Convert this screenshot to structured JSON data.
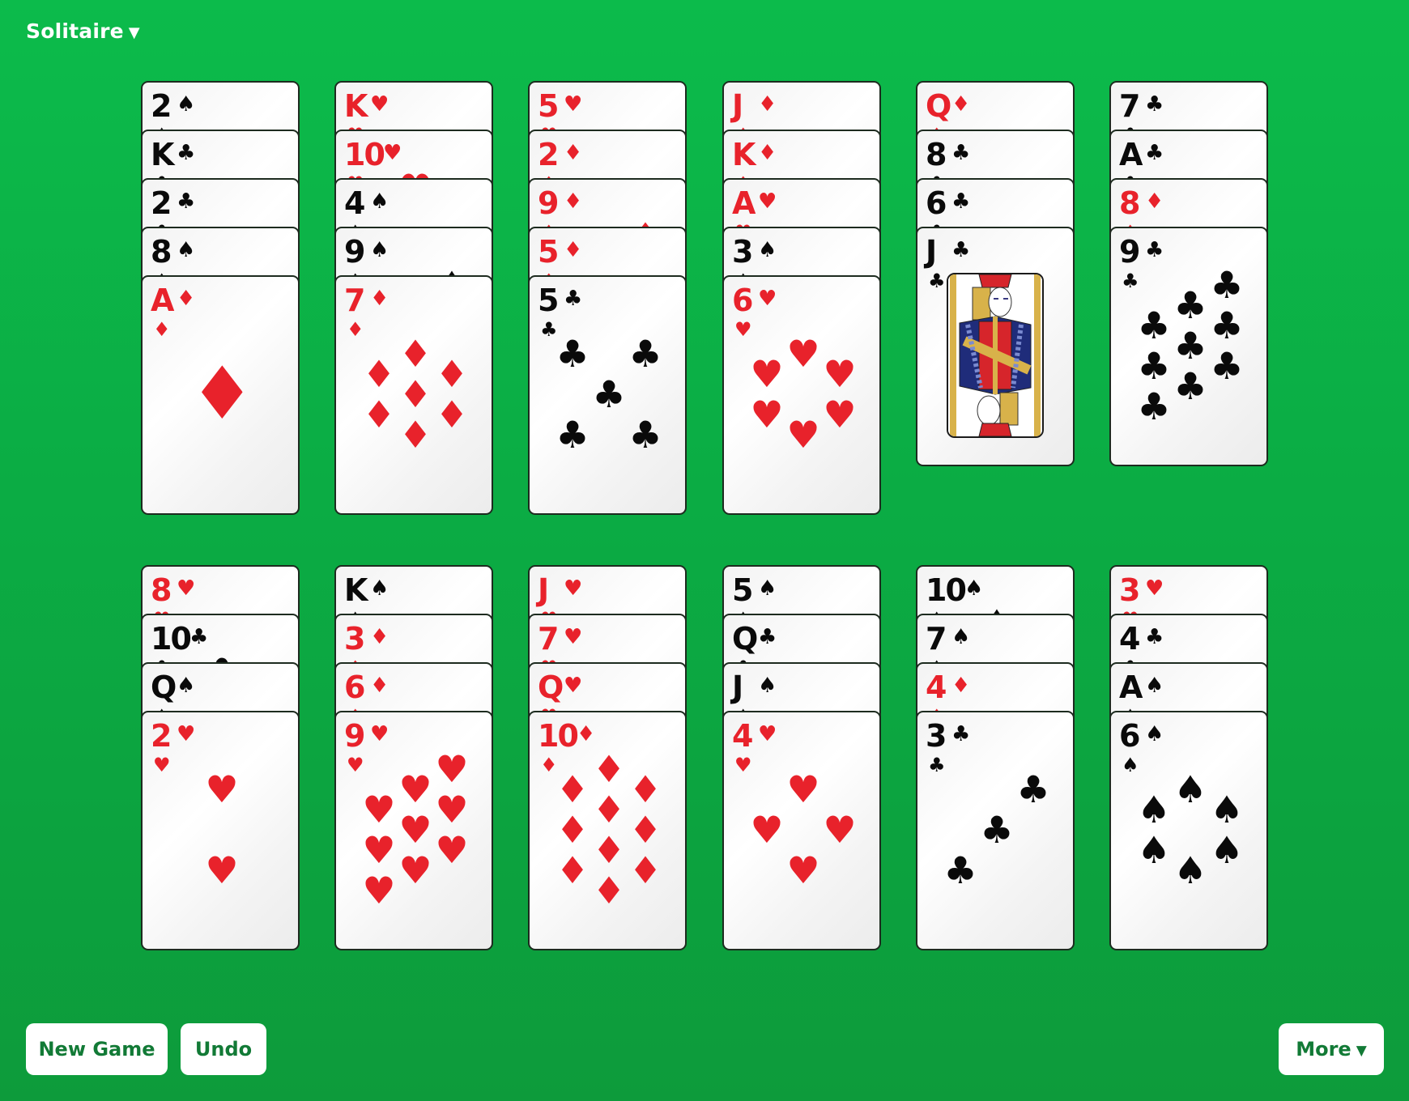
{
  "app": {
    "title": "Solitaire",
    "title_caret": "▼"
  },
  "colors": {
    "felt_top": "#0cbb4b",
    "felt_bottom": "#0d9b3b",
    "red_suit": "#e8222b",
    "black_suit": "#0a0a0a",
    "button_text": "#127a36"
  },
  "suits": {
    "spades": {
      "symbol": "♠",
      "color": "black",
      "icon": "spade-icon"
    },
    "hearts": {
      "symbol": "♥",
      "color": "red",
      "icon": "heart-icon"
    },
    "diamonds": {
      "symbol": "♦",
      "color": "red",
      "icon": "diamond-icon"
    },
    "clubs": {
      "symbol": "♣",
      "color": "black",
      "icon": "club-icon"
    }
  },
  "tableau": {
    "rows": [
      {
        "name": "top-row",
        "piles": [
          {
            "cards": [
              {
                "rank": "2",
                "suit": "spades"
              },
              {
                "rank": "K",
                "suit": "clubs"
              },
              {
                "rank": "2",
                "suit": "clubs"
              },
              {
                "rank": "8",
                "suit": "spades"
              },
              {
                "rank": "A",
                "suit": "diamonds"
              }
            ]
          },
          {
            "cards": [
              {
                "rank": "K",
                "suit": "hearts"
              },
              {
                "rank": "10",
                "suit": "hearts"
              },
              {
                "rank": "4",
                "suit": "spades"
              },
              {
                "rank": "9",
                "suit": "spades"
              },
              {
                "rank": "7",
                "suit": "diamonds"
              }
            ]
          },
          {
            "cards": [
              {
                "rank": "5",
                "suit": "hearts"
              },
              {
                "rank": "2",
                "suit": "diamonds"
              },
              {
                "rank": "9",
                "suit": "diamonds"
              },
              {
                "rank": "5",
                "suit": "diamonds"
              },
              {
                "rank": "5",
                "suit": "clubs"
              }
            ]
          },
          {
            "cards": [
              {
                "rank": "J",
                "suit": "diamonds"
              },
              {
                "rank": "K",
                "suit": "diamonds"
              },
              {
                "rank": "A",
                "suit": "hearts"
              },
              {
                "rank": "3",
                "suit": "spades"
              },
              {
                "rank": "6",
                "suit": "hearts"
              }
            ]
          },
          {
            "cards": [
              {
                "rank": "Q",
                "suit": "diamonds"
              },
              {
                "rank": "8",
                "suit": "clubs"
              },
              {
                "rank": "6",
                "suit": "clubs"
              },
              {
                "rank": "J",
                "suit": "clubs"
              }
            ]
          },
          {
            "cards": [
              {
                "rank": "7",
                "suit": "clubs"
              },
              {
                "rank": "A",
                "suit": "clubs"
              },
              {
                "rank": "8",
                "suit": "diamonds"
              },
              {
                "rank": "9",
                "suit": "clubs"
              }
            ]
          }
        ]
      },
      {
        "name": "bottom-row",
        "piles": [
          {
            "cards": [
              {
                "rank": "8",
                "suit": "hearts"
              },
              {
                "rank": "10",
                "suit": "clubs"
              },
              {
                "rank": "Q",
                "suit": "spades"
              },
              {
                "rank": "2",
                "suit": "hearts"
              }
            ]
          },
          {
            "cards": [
              {
                "rank": "K",
                "suit": "spades"
              },
              {
                "rank": "3",
                "suit": "diamonds"
              },
              {
                "rank": "6",
                "suit": "diamonds"
              },
              {
                "rank": "9",
                "suit": "hearts"
              }
            ]
          },
          {
            "cards": [
              {
                "rank": "J",
                "suit": "hearts"
              },
              {
                "rank": "7",
                "suit": "hearts"
              },
              {
                "rank": "Q",
                "suit": "hearts"
              },
              {
                "rank": "10",
                "suit": "diamonds"
              }
            ]
          },
          {
            "cards": [
              {
                "rank": "5",
                "suit": "spades"
              },
              {
                "rank": "Q",
                "suit": "clubs"
              },
              {
                "rank": "J",
                "suit": "spades"
              },
              {
                "rank": "4",
                "suit": "hearts"
              }
            ]
          },
          {
            "cards": [
              {
                "rank": "10",
                "suit": "spades"
              },
              {
                "rank": "7",
                "suit": "spades"
              },
              {
                "rank": "4",
                "suit": "diamonds"
              },
              {
                "rank": "3",
                "suit": "clubs"
              }
            ]
          },
          {
            "cards": [
              {
                "rank": "3",
                "suit": "hearts"
              },
              {
                "rank": "4",
                "suit": "clubs"
              },
              {
                "rank": "A",
                "suit": "spades"
              },
              {
                "rank": "6",
                "suit": "spades"
              }
            ]
          }
        ]
      }
    ]
  },
  "buttons": {
    "new_game": "New Game",
    "undo": "Undo",
    "more": "More",
    "more_caret": "▼"
  }
}
